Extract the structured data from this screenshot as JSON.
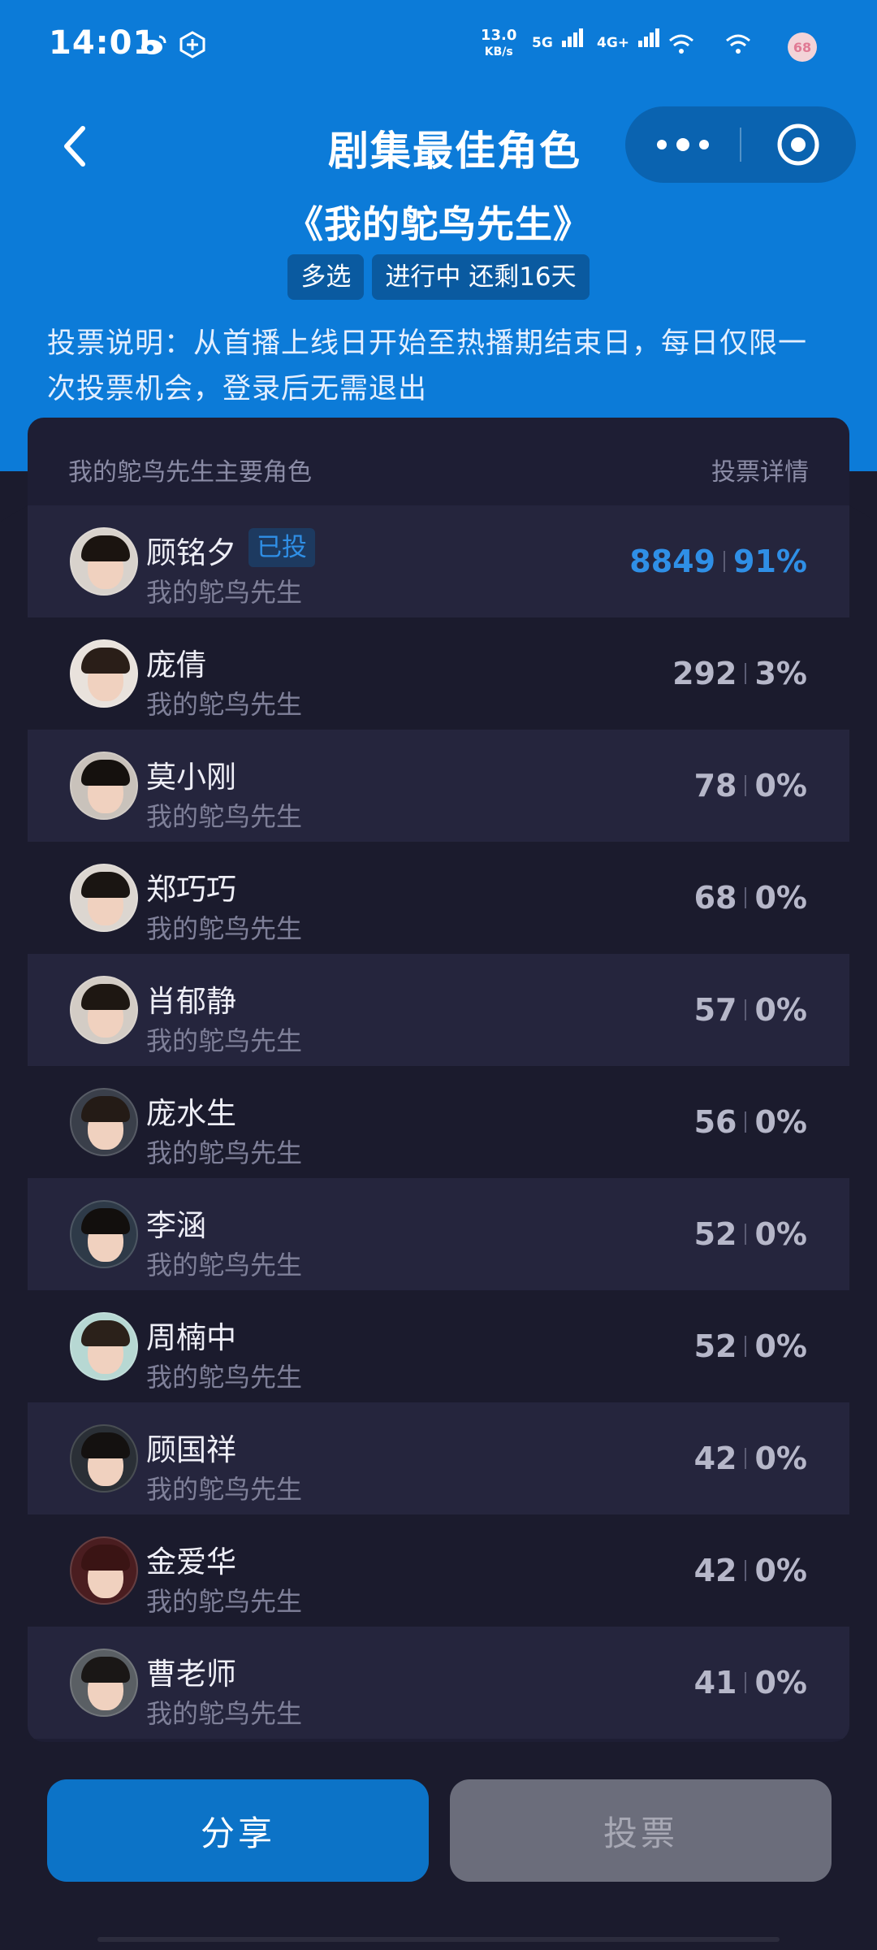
{
  "status_bar": {
    "time": "14:01",
    "net_speed": "13.0",
    "net_unit": "KB/s",
    "sig1": "5G",
    "sig2": "4G+",
    "battery": "68",
    "icons": [
      "weibo-icon",
      "hexagon-app-icon",
      "wifi-icon",
      "wifi-icon"
    ]
  },
  "header": {
    "title": "剧集最佳角色",
    "subtitle": "《我的鸵鸟先生》",
    "tags": [
      "多选",
      "进行中 还剩16天"
    ],
    "description": "投票说明：从首播上线日开始至热播期结束日，每日仅限一次投票机会，登录后无需退出"
  },
  "list": {
    "header_left": "我的鸵鸟先生主要角色",
    "header_right": "投票详情",
    "voted_label": "已投",
    "items": [
      {
        "name": "顾铭夕",
        "show": "我的鸵鸟先生",
        "votes": "8849",
        "percent": "91%",
        "voted": true
      },
      {
        "name": "庞倩",
        "show": "我的鸵鸟先生",
        "votes": "292",
        "percent": "3%"
      },
      {
        "name": "莫小刚",
        "show": "我的鸵鸟先生",
        "votes": "78",
        "percent": "0%"
      },
      {
        "name": "郑巧巧",
        "show": "我的鸵鸟先生",
        "votes": "68",
        "percent": "0%"
      },
      {
        "name": "肖郁静",
        "show": "我的鸵鸟先生",
        "votes": "57",
        "percent": "0%"
      },
      {
        "name": "庞水生",
        "show": "我的鸵鸟先生",
        "votes": "56",
        "percent": "0%"
      },
      {
        "name": "李涵",
        "show": "我的鸵鸟先生",
        "votes": "52",
        "percent": "0%"
      },
      {
        "name": "周楠中",
        "show": "我的鸵鸟先生",
        "votes": "52",
        "percent": "0%"
      },
      {
        "name": "顾国祥",
        "show": "我的鸵鸟先生",
        "votes": "42",
        "percent": "0%"
      },
      {
        "name": "金爱华",
        "show": "我的鸵鸟先生",
        "votes": "42",
        "percent": "0%"
      },
      {
        "name": "曹老师",
        "show": "我的鸵鸟先生",
        "votes": "41",
        "percent": "0%"
      }
    ]
  },
  "buttons": {
    "share": "分享",
    "vote": "投票"
  },
  "colors": {
    "brand_blue": "#0c7bd8",
    "highlight_blue": "#2f8fe6",
    "bg_dark": "#1b1b2d"
  }
}
